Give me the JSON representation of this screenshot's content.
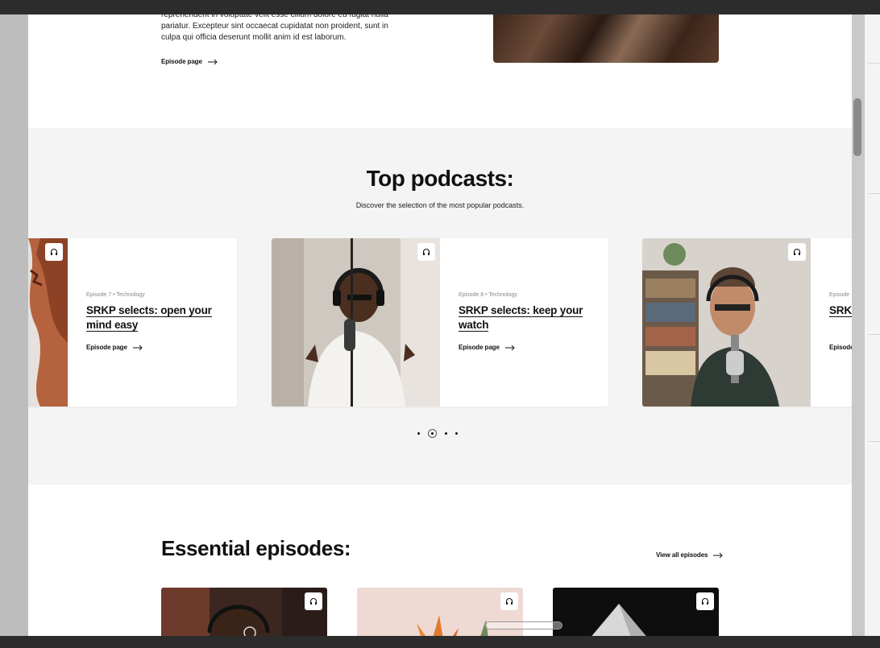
{
  "intro": {
    "text": "reprehenderit in voluptate velit esse cillum dolore eu fugiat nulla pariatur. Excepteur sint occaecat cupidatat non proident, sunt in culpa qui officia deserunt mollit anim id est laborum.",
    "link_label": "Episode page"
  },
  "top_podcasts": {
    "title": "Top podcasts:",
    "subtitle": "Discover the selection of the most popular podcasts.",
    "cards": [
      {
        "meta": "Episode 7 • Technology",
        "title": "SRKP selects: open your mind easy",
        "link_label": "Episode page",
        "icon": "headphones-icon"
      },
      {
        "meta": "Episode 8 • Technology",
        "title": "SRKP selects: keep your watch",
        "link_label": "Episode page",
        "icon": "headphones-icon"
      },
      {
        "meta": "Episode",
        "title": "SRK behi",
        "link_label": "Episode",
        "icon": "headphones-icon"
      }
    ],
    "pagination": {
      "count": 4,
      "active": 2
    }
  },
  "essential": {
    "title": "Essential episodes:",
    "view_all_label": "View all episodes"
  },
  "colors": {
    "section_bg": "#f4f4f4",
    "text": "#111111",
    "meta": "#888888"
  }
}
